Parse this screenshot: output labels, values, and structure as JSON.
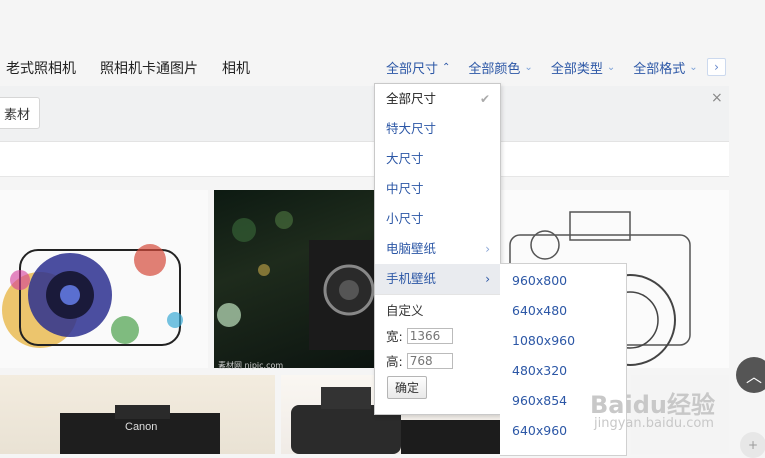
{
  "tags": [
    "老式照相机",
    "照相机卡通图片",
    "相机"
  ],
  "filters": [
    {
      "label": "全部尺寸",
      "active": true
    },
    {
      "label": "全部颜色",
      "active": false
    },
    {
      "label": "全部类型",
      "active": false
    },
    {
      "label": "全部格式",
      "active": false
    }
  ],
  "panel": {
    "button_label": "素材",
    "close_icon": "×"
  },
  "size_menu": {
    "items": [
      {
        "label": "全部尺寸",
        "selected": true
      },
      {
        "label": "特大尺寸"
      },
      {
        "label": "大尺寸"
      },
      {
        "label": "中尺寸"
      },
      {
        "label": "小尺寸"
      },
      {
        "label": "电脑壁纸",
        "has_submenu": true
      },
      {
        "label": "手机壁纸",
        "has_submenu": true,
        "hovered": true
      }
    ],
    "custom_label": "自定义",
    "width_label": "宽:",
    "width_placeholder": "1366",
    "height_label": "高:",
    "height_placeholder": "768",
    "ok_label": "确定"
  },
  "phone_sizes": [
    "960x800",
    "640x480",
    "1080x960",
    "480x320",
    "960x854",
    "640x960"
  ],
  "image_caption": "素材网 nipic.com",
  "watermark": {
    "main": "Baidu经验",
    "sub": "jingyan.baidu.com"
  },
  "colors": {
    "link": "#2c57a6",
    "hover_bg": "#e9ebef"
  }
}
